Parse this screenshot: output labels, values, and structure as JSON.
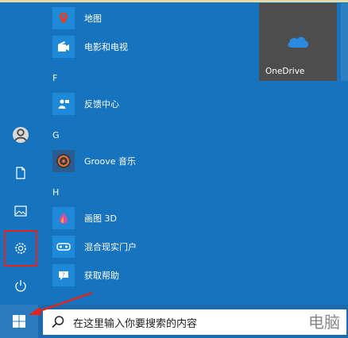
{
  "apps": {
    "maps": "地图",
    "movies_tv": "电影和电视",
    "letter_f": "F",
    "feedback_hub": "反馈中心",
    "letter_g": "G",
    "groove": "Groove 音乐",
    "letter_h": "H",
    "paint3d": "画图 3D",
    "mixed_reality": "混合现实门户",
    "get_help": "获取帮助"
  },
  "tiles": {
    "onedrive": "OneDrive"
  },
  "taskbar": {
    "search_placeholder": "在这里输入你要搜索的内容",
    "watermark": "电脑"
  },
  "colors": {
    "menu_bg": "#1673be",
    "tile_bg": "#1e88d9",
    "highlight": "#e4231d"
  }
}
